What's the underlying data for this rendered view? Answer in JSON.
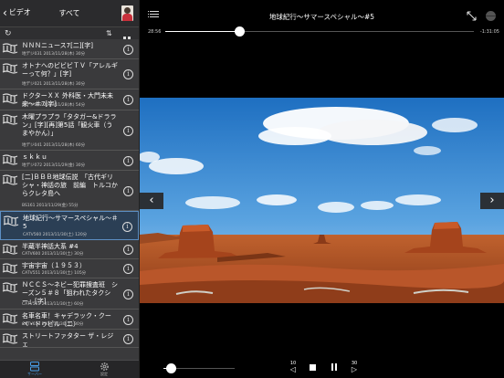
{
  "left_panel": {
    "back_label": "ビデオ",
    "title": "すべて"
  },
  "list": [
    {
      "title": "ＮＮＮニュース7[二][字]",
      "meta": "地デジ031  2013/11/28(木)  30分",
      "selected": false
    },
    {
      "title": "オトナへのビビビＴＶ「アレルギーって何？」[字]",
      "meta": "地デジ021  2013/11/28(木)  30分",
      "selected": false
    },
    {
      "title": "ドクターＸＸ 外科医・大門未未来～＃7[字]",
      "meta": "地デジ012  2013/11/28(木)  54分",
      "selected": false
    },
    {
      "title": "木曜プラプラ「タタガー&ドララン」[字][再]第5話「観火車（うまやかん）」",
      "meta": "地デジ041  2013/11/28(木)  60分",
      "selected": false
    },
    {
      "title": "ｓｋｋｕ",
      "meta": "地デジ072  2013/11/29(金)  30分",
      "selected": false
    },
    {
      "title": "[二]ＢＢＢ地球伝説　「古代ギリシャ・神話の旅　前編　トルコからクレタ島へ",
      "meta": "BS161  2013/11/29(金)  55分",
      "selected": false
    },
    {
      "title": "地球紀行～サマースペシャル～＃5",
      "meta": "CATV560  2013/11/30(土)  120分",
      "selected": true
    },
    {
      "title": "半蔵半神話大系 #4",
      "meta": "CATV600  2013/11/30(土)  30分",
      "selected": false
    },
    {
      "title": "宇宙宇宙（１９５３）",
      "meta": "CATV551  2013/11/30(土)  105分",
      "selected": false
    },
    {
      "title": "ＮＣＣＳ～ネビー犯罪捜査班　シーズン５＃８「狙われたタクシー」[字]",
      "meta": "CATV561  2013/11/30(土)  60分",
      "selected": false
    },
    {
      "title": "名車名車！キャデラック・クーペ・ドゥビル（二）",
      "meta": "CATV652  2013/11/30(土)  30分",
      "selected": false
    },
    {
      "title": "ストリートファタター ザ・レジェ",
      "meta": "",
      "selected": false
    }
  ],
  "tabbar": [
    {
      "label": "サーバー",
      "active": true
    },
    {
      "label": "設定",
      "active": false
    }
  ],
  "player": {
    "title": "地球紀行～サマースペシャル～#5",
    "elapsed": "28:56",
    "remaining": "-1:31:05",
    "progress": 0.24,
    "volume": 0.1,
    "skip_back_label": "10",
    "skip_forward_label": "30"
  },
  "icons": [
    "back-chevron-icon",
    "avatar-icon",
    "refresh-icon",
    "sort-icon",
    "grid-view-icon",
    "recording-icon",
    "info-icon",
    "server-icon",
    "settings-gear-icon",
    "menu-icon",
    "expand-icon",
    "globe-icon",
    "skip-back-icon",
    "stop-icon",
    "pause-icon",
    "skip-forward-icon",
    "prev-arrow-icon",
    "next-arrow-icon"
  ],
  "colors": {
    "accent": "#4a9fe8",
    "selected_bg": "#2b3f55",
    "panel_bg": "#3a3a3c",
    "player_bg": "#000000"
  }
}
